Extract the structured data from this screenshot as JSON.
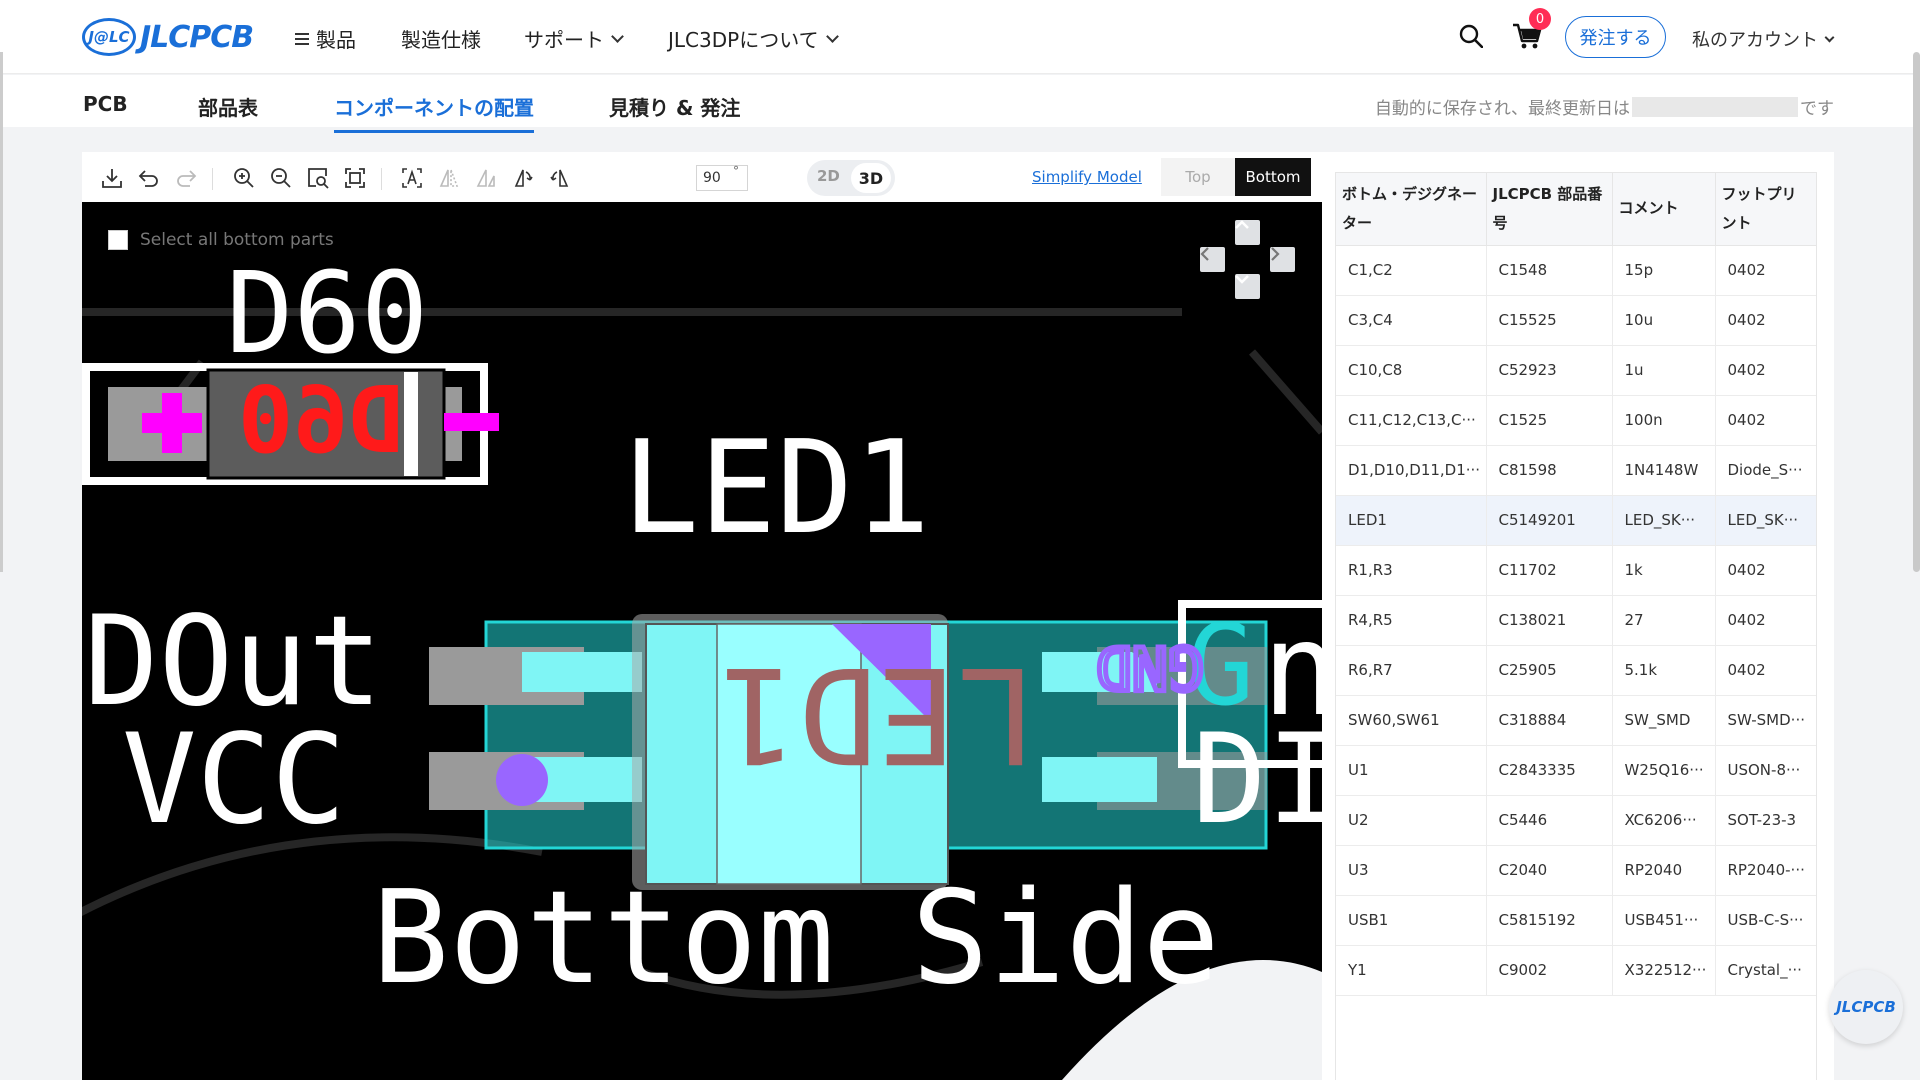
{
  "brand": {
    "badge": "J@LC",
    "name": "JLCPCB"
  },
  "topnav": {
    "products": "製品",
    "manufacturing": "製造仕様",
    "support": "サポート",
    "about": "JLC3DPについて",
    "cart_count": "0",
    "order_button": "発注する",
    "account": "私のアカウント"
  },
  "subtabs": [
    "PCB",
    "部品表",
    "コンポーネントの配置",
    "見積り & 発注"
  ],
  "save_status": {
    "prefix": "自動的に保存され、最終更新日は",
    "suffix": "です"
  },
  "toolbar": {
    "rotation_value": "90",
    "degree_symbol": "°",
    "view_2d": "2D",
    "view_3d": "3D",
    "simplify_link": "Simplify Model",
    "side_top": "Top",
    "side_bottom": "Bottom"
  },
  "viewer": {
    "select_all_label": "Select all bottom parts",
    "silk": {
      "d60": "D60",
      "led1": "LED1",
      "dout": "DOut",
      "vcc": "VCC",
      "bottom_side": "Bottom Side",
      "d60_mirror": "D60",
      "led1_mirror": "LED1",
      "gnd": "GND",
      "g": "G",
      "n": "n",
      "di": "DI",
      "plus": "+",
      "minus": "−"
    },
    "colors": {
      "board": "#000000",
      "silkscreen": "#ffffff",
      "selection": "#23d6d6",
      "pad": "#9a9a9a",
      "highlight": "#ff00ff"
    }
  },
  "parts_table": {
    "headers": [
      "ボトム・デジグネーター",
      "JLCPCB 部品番号",
      "コメント",
      "フットプリント"
    ],
    "rows": [
      [
        "C1,C2",
        "C1548",
        "15p",
        "0402"
      ],
      [
        "C3,C4",
        "C15525",
        "10u",
        "0402"
      ],
      [
        "C10,C8",
        "C52923",
        "1u",
        "0402"
      ],
      [
        "C11,C12,C13,C···",
        "C1525",
        "100n",
        "0402"
      ],
      [
        "D1,D10,D11,D1···",
        "C81598",
        "1N4148W",
        "Diode_S···"
      ],
      [
        "LED1",
        "C5149201",
        "LED_SK···",
        "LED_SK···"
      ],
      [
        "R1,R3",
        "C11702",
        "1k",
        "0402"
      ],
      [
        "R4,R5",
        "C138021",
        "27",
        "0402"
      ],
      [
        "R6,R7",
        "C25905",
        "5.1k",
        "0402"
      ],
      [
        "SW60,SW61",
        "C318884",
        "SW_SMD",
        "SW-SMD···"
      ],
      [
        "U1",
        "C2843335",
        "W25Q16···",
        "USON-8···"
      ],
      [
        "U2",
        "C5446",
        "XC6206···",
        "SOT-23-3"
      ],
      [
        "U3",
        "C2040",
        "RP2040",
        "RP2040-···"
      ],
      [
        "USB1",
        "C5815192",
        "USB451···",
        "USB-C-S···"
      ],
      [
        "Y1",
        "C9002",
        "X322512···",
        "Crystal_···"
      ]
    ],
    "selected_designator": "LED1"
  },
  "float_logo": "JLCPCB"
}
